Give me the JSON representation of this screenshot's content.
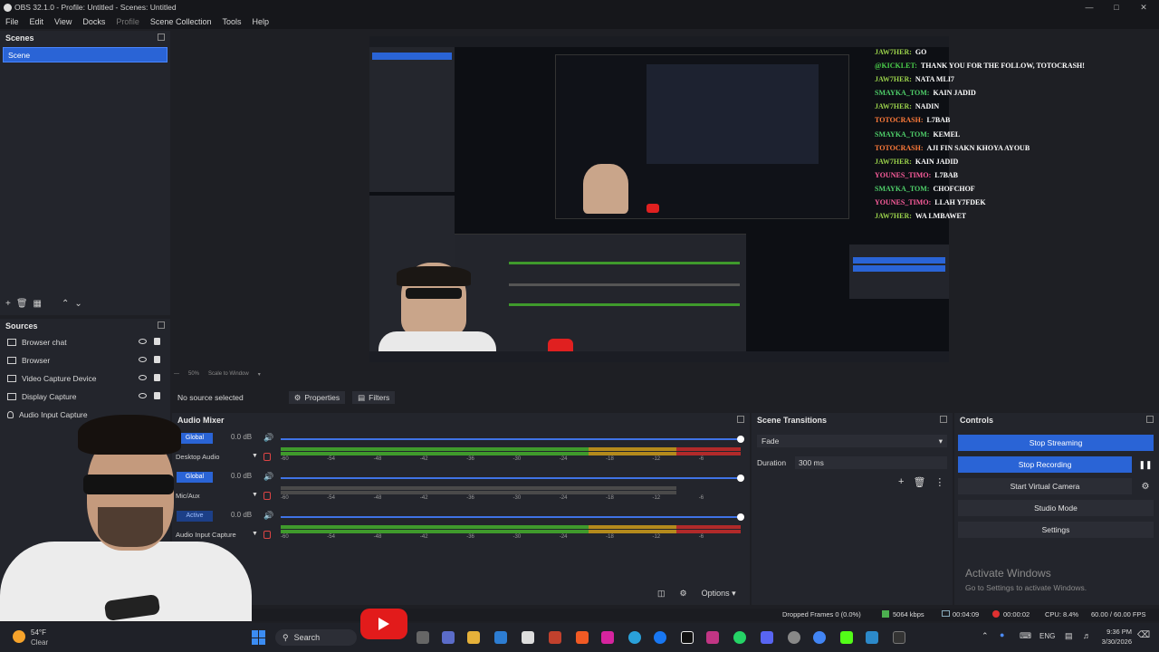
{
  "window": {
    "title": "OBS 32.1.0 - Profile: Untitled - Scenes: Untitled",
    "controls": [
      "—",
      "□",
      "✕"
    ]
  },
  "menu": [
    "File",
    "Edit",
    "View",
    "Docks",
    "Profile",
    "Scene Collection",
    "Tools",
    "Help"
  ],
  "scenes": {
    "title": "Scenes",
    "items": [
      "Scene"
    ]
  },
  "sources": {
    "title": "Sources",
    "items": [
      "Browser chat",
      "Browser",
      "Video Capture Device",
      "Display Capture",
      "Audio Input Capture"
    ]
  },
  "chat": [
    {
      "user": "JAW7HER:",
      "msg": "GO",
      "color": "#9ad14b"
    },
    {
      "user": "@KICKLET:",
      "msg": "THANK YOU FOR THE FOLLOW, TOTOCRASH!",
      "color": "#4bd14b"
    },
    {
      "user": "JAW7HER:",
      "msg": "NATA MLI7",
      "color": "#9ad14b"
    },
    {
      "user": "SMAYKA_TOM:",
      "msg": "KAIN JADID",
      "color": "#4fd06a"
    },
    {
      "user": "JAW7HER:",
      "msg": "NADIN",
      "color": "#9ad14b"
    },
    {
      "user": "TOTOCRASH:",
      "msg": "L7BAB",
      "color": "#ff7b3a"
    },
    {
      "user": "SMAYKA_TOM:",
      "msg": "KEMEL",
      "color": "#4fd06a"
    },
    {
      "user": "TOTOCRASH:",
      "msg": "AJI FIN SAKN KHOYA AYOUB",
      "color": "#ff7b3a"
    },
    {
      "user": "JAW7HER:",
      "msg": "KAIN JADID",
      "color": "#9ad14b"
    },
    {
      "user": "YOUNES_TIMO:",
      "msg": "L7BAB",
      "color": "#ff5e9e"
    },
    {
      "user": "SMAYKA_TOM:",
      "msg": "CHOFCHOF",
      "color": "#4fd06a"
    },
    {
      "user": "YOUNES_TIMO:",
      "msg": "LLAH Y7FDEK",
      "color": "#ff5e9e"
    },
    {
      "user": "JAW7HER:",
      "msg": "WA LMBAWET",
      "color": "#9ad14b"
    }
  ],
  "context": {
    "no_source": "No source selected",
    "properties": "Properties",
    "filters": "Filters"
  },
  "mixer": {
    "title": "Audio Mixer",
    "channels": [
      {
        "chip": "Global",
        "db": "0.0 dB",
        "name": "Desktop Audio",
        "volume": 1.0
      },
      {
        "chip": "Global",
        "db": "0.0 dB",
        "name": "Mic/Aux",
        "volume": 1.0
      },
      {
        "chip": "Active",
        "db": "0.0 dB",
        "name": "Audio Input Capture",
        "volume": 1.0
      }
    ],
    "ticks": [
      "-60",
      "-54",
      "-48",
      "-42",
      "-36",
      "-30",
      "-24",
      "-18",
      "-12",
      "-6"
    ],
    "options": "Options"
  },
  "transitions": {
    "title": "Scene Transitions",
    "selected": "Fade",
    "duration_label": "Duration",
    "duration_value": "300 ms"
  },
  "controls": {
    "title": "Controls",
    "buttons": [
      "Stop Streaming",
      "Stop Recording",
      "Start Virtual Camera",
      "Studio Mode",
      "Settings"
    ]
  },
  "watermark": {
    "title": "Activate Windows",
    "sub": "Go to Settings to activate Windows."
  },
  "status": {
    "dropped": "Dropped Frames 0 (0.0%)",
    "kbps": "5064 kbps",
    "stream_time": "00:04:09",
    "rec_time": "00:00:02",
    "cpu": "CPU: 8.4%",
    "fps": "60.00 / 60.00 FPS"
  },
  "taskbar": {
    "weather_temp": "54°F",
    "weather_desc": "Clear",
    "search": "Search",
    "lang": "ENG",
    "time": "9:36 PM",
    "date": "3/30/2026"
  },
  "colors": {
    "accent": "#2a64d6",
    "green": "#3f9a2c",
    "yellow": "#b48a1c",
    "red": "#b12a2a"
  }
}
